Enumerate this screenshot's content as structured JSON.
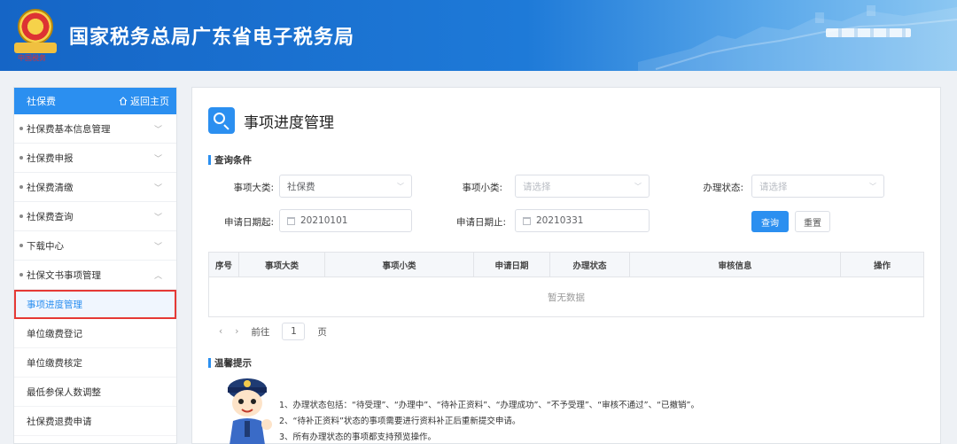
{
  "header": {
    "site_title": "国家税务总局广东省电子税务局",
    "emblem_caption": "中国税务"
  },
  "sidebar": {
    "title": "社保费",
    "home_label": "返回主页",
    "items": [
      {
        "label": "社保费基本信息管理",
        "expanded": false
      },
      {
        "label": "社保费申报",
        "expanded": false
      },
      {
        "label": "社保费清缴",
        "expanded": false
      },
      {
        "label": "社保费查询",
        "expanded": false
      },
      {
        "label": "下载中心",
        "expanded": false
      },
      {
        "label": "社保文书事项管理",
        "expanded": true
      }
    ],
    "sub_items": [
      {
        "label": "事项进度管理",
        "active": true
      },
      {
        "label": "单位缴费登记",
        "active": false
      },
      {
        "label": "单位缴费核定",
        "active": false
      },
      {
        "label": "最低参保人数调整",
        "active": false
      },
      {
        "label": "社保费退费申请",
        "active": false
      }
    ]
  },
  "main": {
    "page_title": "事项进度管理",
    "query_section": "查询条件",
    "fields": {
      "category_label": "事项大类:",
      "category_value": "社保费",
      "subcategory_label": "事项小类:",
      "subcategory_placeholder": "请选择",
      "status_label": "办理状态:",
      "status_placeholder": "请选择",
      "date_from_label": "申请日期起:",
      "date_from_value": "20210101",
      "date_to_label": "申请日期止:",
      "date_to_value": "20210331"
    },
    "search_button": "查询",
    "reset_button": "重置",
    "table": {
      "columns": [
        "序号",
        "事项大类",
        "事项小类",
        "申请日期",
        "办理状态",
        "审核信息",
        "操作"
      ],
      "empty_text": "暂无数据"
    },
    "pager": {
      "prev": "‹",
      "next": "›",
      "goto_label": "前往",
      "page": "1",
      "page_suffix": "页"
    },
    "tips_section": "温馨提示",
    "tips": [
      "1、办理状态包括：“待受理”、“办理中”、“待补正资料”、“办理成功”、“不予受理”、“审核不通过”、“已撤销”。",
      "2、“待补正资料”状态的事项需要进行资料补正后重新提交申请。",
      "3、所有办理状态的事项都支持预览操作。"
    ]
  },
  "colors": {
    "primary": "#2b8ff0",
    "header": "#1565c6",
    "highlight_border": "#e53935"
  }
}
